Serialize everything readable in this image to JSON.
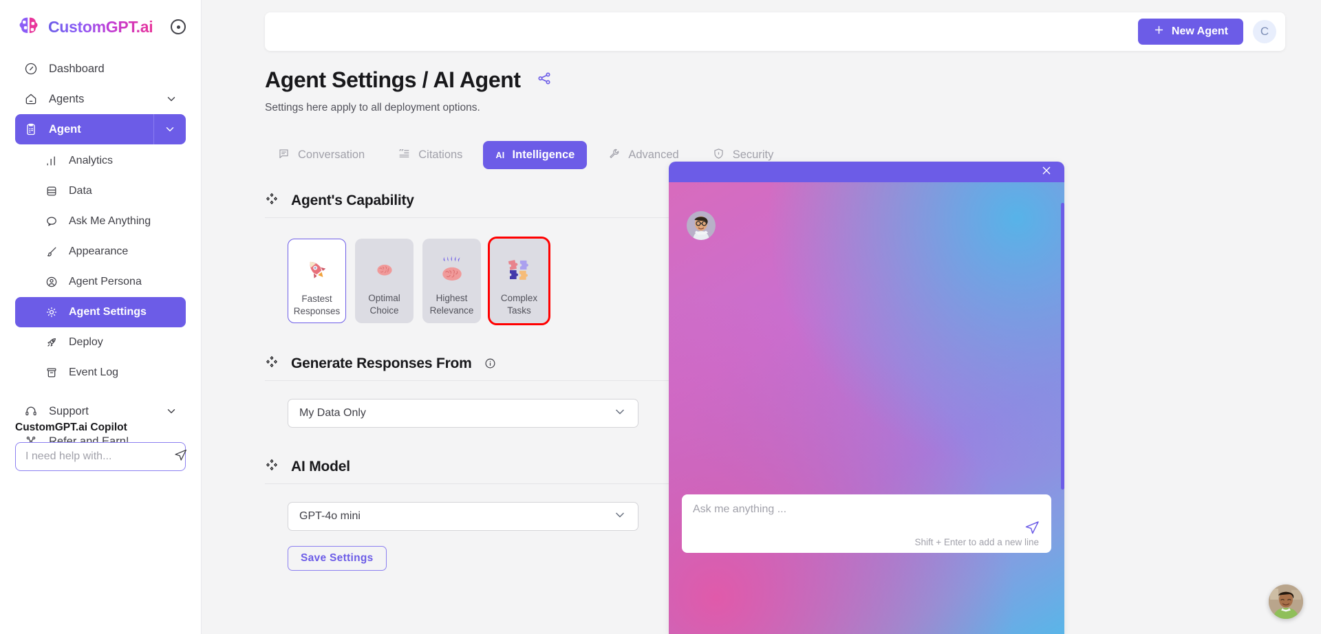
{
  "brand": {
    "name": "CustomGPT.ai",
    "collapse_icon": "circle-dot-icon"
  },
  "sidebar": {
    "items": [
      {
        "label": "Dashboard",
        "icon": "gauge-icon",
        "state": "default"
      },
      {
        "label": "Agents",
        "icon": "home-icon",
        "state": "expandable"
      },
      {
        "label": "Agent",
        "icon": "clipboard-icon",
        "state": "active"
      }
    ],
    "sub_items": [
      {
        "label": "Analytics",
        "icon": "bar-chart-icon",
        "state": "default"
      },
      {
        "label": "Data",
        "icon": "database-icon",
        "state": "default"
      },
      {
        "label": "Ask Me Anything",
        "icon": "chat-icon",
        "state": "default"
      },
      {
        "label": "Appearance",
        "icon": "brush-icon",
        "state": "default"
      },
      {
        "label": "Agent Persona",
        "icon": "user-circle-icon",
        "state": "default"
      },
      {
        "label": "Agent Settings",
        "icon": "gear-icon",
        "state": "active"
      },
      {
        "label": "Deploy",
        "icon": "rocket-icon",
        "state": "default"
      },
      {
        "label": "Event Log",
        "icon": "archive-icon",
        "state": "default"
      }
    ],
    "footer_items": [
      {
        "label": "Support",
        "icon": "headphones-icon",
        "state": "expandable"
      },
      {
        "label": "Refer and Earn!",
        "icon": "share-nodes-icon",
        "state": "default"
      }
    ],
    "copilot": {
      "title": "CustomGPT.ai Copilot",
      "placeholder": "I need help with...",
      "value": "",
      "send_icon": "send-icon"
    }
  },
  "topbar": {
    "new_agent_label": "New Agent",
    "plus_icon": "plus-icon",
    "avatar_initial": "C"
  },
  "page": {
    "title": "Agent Settings / AI Agent",
    "share_icon": "share-icon",
    "subtitle": "Settings here apply to all deployment options."
  },
  "tabs": [
    {
      "label": "Conversation",
      "icon": "speech-bubble-icon",
      "active": false
    },
    {
      "label": "Citations",
      "icon": "quote-list-icon",
      "active": false
    },
    {
      "label": "Intelligence",
      "icon": "ai-glyph-icon",
      "active": true
    },
    {
      "label": "Advanced",
      "icon": "wrench-icon",
      "active": false
    },
    {
      "label": "Security",
      "icon": "shield-icon",
      "active": false
    }
  ],
  "sections": {
    "capability": {
      "title": "Agent's Capability",
      "heading_icon": "diamond-cluster-icon",
      "cards": [
        {
          "label": "Fastest Responses",
          "icon": "rocket-emoji-icon",
          "selected": true,
          "annotated": false
        },
        {
          "label": "Optimal Choice",
          "icon": "brain-emoji-icon",
          "selected": false,
          "annotated": false
        },
        {
          "label": "Highest Relevance",
          "icon": "brain-zap-emoji-icon",
          "selected": false,
          "annotated": false
        },
        {
          "label": "Complex Tasks",
          "icon": "puzzle-emoji-icon",
          "selected": false,
          "annotated": true
        }
      ]
    },
    "generate_from": {
      "title": "Generate Responses From",
      "heading_icon": "diamond-cluster-icon",
      "info_icon": "info-circle-icon",
      "selected": "My Data Only",
      "chevron_icon": "chevron-down-icon"
    },
    "ai_model": {
      "title": "AI Model",
      "heading_icon": "diamond-cluster-icon",
      "selected": "GPT-4o mini",
      "chevron_icon": "chevron-down-icon"
    },
    "save_label": "Save Settings"
  },
  "chat_widget": {
    "close_icon": "close-icon",
    "avatar": "agent-avatar",
    "input_placeholder": "Ask me anything ...",
    "input_value": "",
    "hint": "Shift + Enter to add a new line",
    "send_icon": "send-icon"
  },
  "launcher": {
    "icon": "chat-launcher-avatar"
  },
  "colors": {
    "accent": "#6c5ce7",
    "annotation": "#ff0000",
    "sidebar_text": "#3f3f46",
    "muted": "#a1a1aa"
  }
}
